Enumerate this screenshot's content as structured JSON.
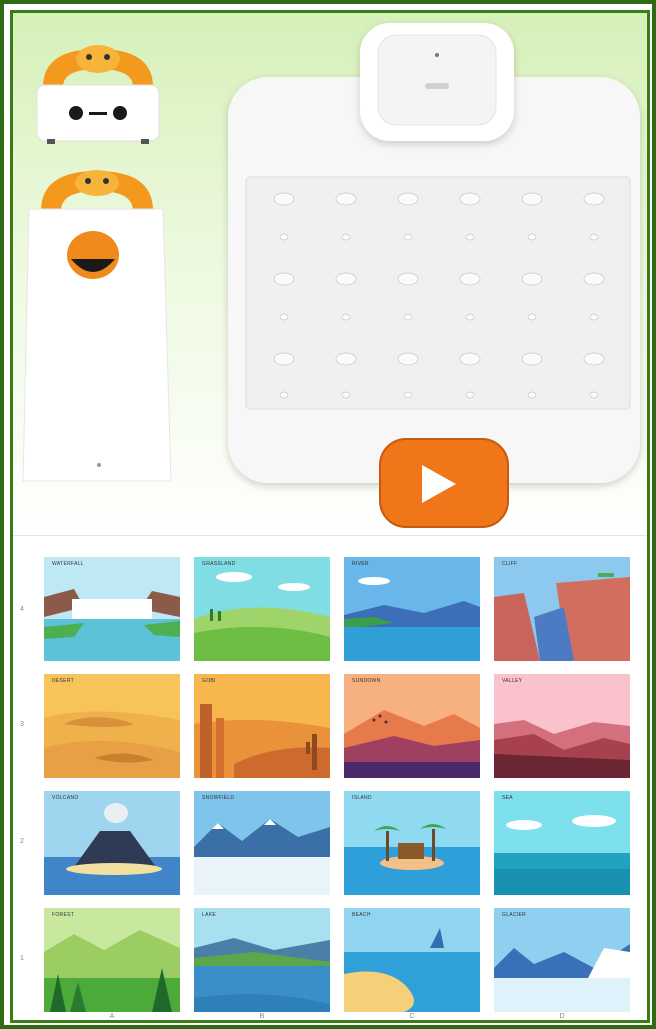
{
  "grid": {
    "row_labels": [
      "4",
      "3",
      "2",
      "1"
    ],
    "column_labels": [
      "A",
      "B",
      "C",
      "D"
    ],
    "cells": [
      {
        "scene": "waterfall",
        "label": "WATERFALL"
      },
      {
        "scene": "grassland",
        "label": "GRASSLAND"
      },
      {
        "scene": "river",
        "label": "RIVER"
      },
      {
        "scene": "cliff",
        "label": "CLIFF"
      },
      {
        "scene": "desert",
        "label": "DESERT"
      },
      {
        "scene": "gobi",
        "label": "GOBI"
      },
      {
        "scene": "sundown",
        "label": "SUNDOWN"
      },
      {
        "scene": "valley",
        "label": "VALLEY"
      },
      {
        "scene": "volcano",
        "label": "VOLCANO"
      },
      {
        "scene": "snowfield",
        "label": "SNOWFIELD"
      },
      {
        "scene": "island",
        "label": "ISLAND"
      },
      {
        "scene": "sea",
        "label": "SEA"
      },
      {
        "scene": "forest",
        "label": "FOREST"
      },
      {
        "scene": "lake",
        "label": "LAKE"
      },
      {
        "scene": "beach",
        "label": "BEACH"
      },
      {
        "scene": "glacier",
        "label": "GLACIER"
      }
    ]
  },
  "colors": {
    "frame": "#2f6a14",
    "background_top": "#d6f0b8",
    "robot_accent": "#f39a1e",
    "play_button": "#f0761a"
  },
  "icons": {
    "play": "play-icon"
  }
}
